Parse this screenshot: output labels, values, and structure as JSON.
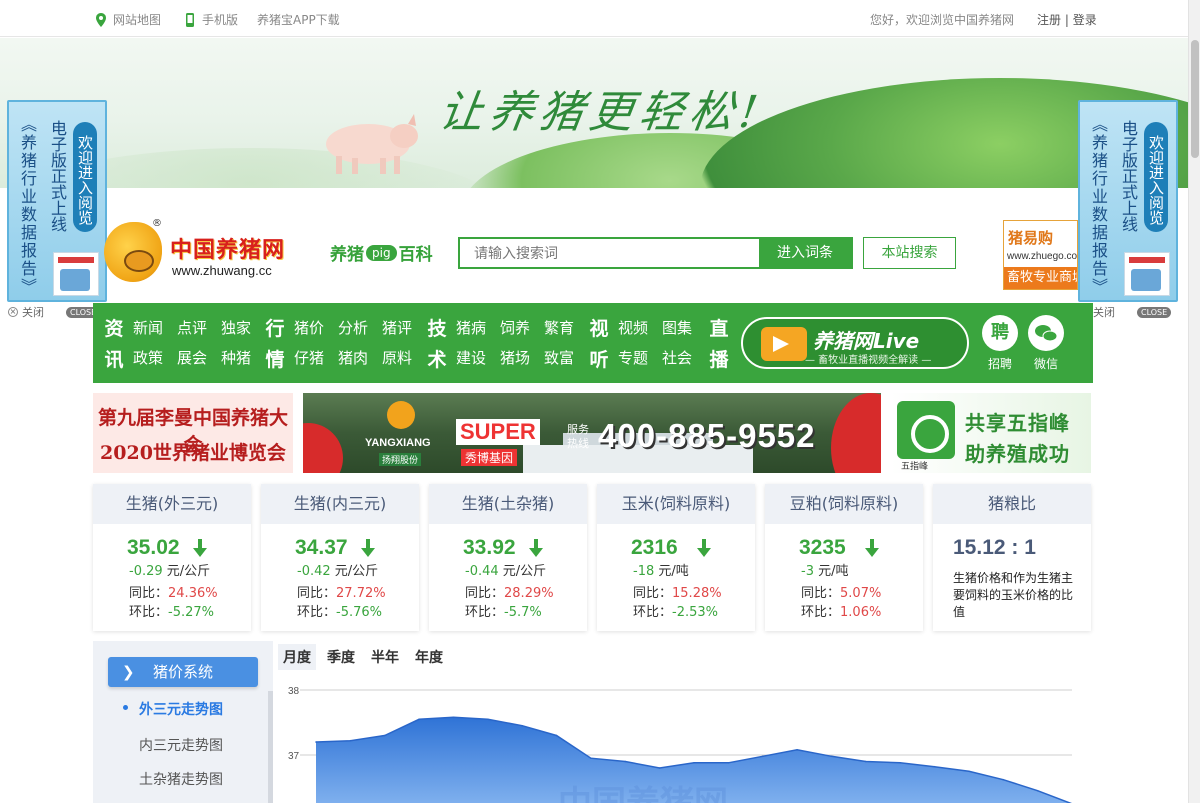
{
  "topbar": {
    "sitemap": "网站地图",
    "mobile": "手机版",
    "app": "养猪宝APP下载",
    "welcome": "您好，欢迎浏览中国养猪网",
    "register": "注册",
    "separator": "|",
    "login": "登录"
  },
  "banner": {
    "slogan": "让养猪更轻松!"
  },
  "float_ads": {
    "left": {
      "line1": "《养猪行业数据报告》",
      "line2": "电子版正式上线",
      "cta": "欢迎进入阅览",
      "close_label": "关闭",
      "close_btn": "CLOSE"
    },
    "right": {
      "line1": "《养猪行业数据报告》",
      "line2": "电子版正式上线",
      "cta": "欢迎进入阅览",
      "close_label": "关闭",
      "close_btn": "CLOSE"
    }
  },
  "logo": {
    "reg": "®",
    "name": "中国养猪网",
    "url": "www.zhuwang.cc"
  },
  "baike": {
    "left": "养猪",
    "tag": "pig",
    "right": "百科"
  },
  "search": {
    "placeholder": "请输入搜索词",
    "enter_btn": "进入词条",
    "site_btn": "本站搜索"
  },
  "zhuego": {
    "title": "猪易购",
    "url": "www.zhuego.com",
    "slogan": "畜牧专业商城"
  },
  "nav": {
    "groups": [
      {
        "big_top": "资",
        "big_bottom": "讯",
        "top": [
          "新闻",
          "点评",
          "独家"
        ],
        "bottom": [
          "政策",
          "展会",
          "种猪"
        ]
      },
      {
        "big_top": "行",
        "big_bottom": "情",
        "top": [
          "猪价",
          "分析",
          "猪评"
        ],
        "bottom": [
          "仔猪",
          "猪肉",
          "原料"
        ]
      },
      {
        "big_top": "技",
        "big_bottom": "术",
        "top": [
          "猪病",
          "饲养",
          "繁育"
        ],
        "bottom": [
          "建设",
          "猪场",
          "致富"
        ]
      },
      {
        "big_top": "视",
        "big_bottom": "听",
        "top": [
          "视频",
          "图集"
        ],
        "bottom": [
          "专题",
          "社会"
        ]
      },
      {
        "big_top": "直",
        "big_bottom": "播",
        "top": [],
        "bottom": []
      }
    ],
    "live_title": "养猪网Live",
    "live_sub": "— 畜牧业直播视频全解读 —",
    "jobs_icon": "聘",
    "jobs": "招聘",
    "wechat": "微信"
  },
  "ads": {
    "ad1": {
      "line1": "第九届李曼中国养猪大会",
      "line2": "2020世界猪业博览会"
    },
    "ad2": {
      "brand1": "YANGXIANG",
      "brand1_sub": "扬翔股份",
      "brand2": "SUPER",
      "brand2_sub": "秀博基因",
      "hotline_label": "服务热线",
      "hotline": "400-885-9552"
    },
    "ad3": {
      "brand": "五指峰",
      "line1": "共享五指峰",
      "line2": "助养殖成功"
    }
  },
  "prices": [
    {
      "title": "生猪(外三元)",
      "price": "35.02",
      "delta": "-0.29",
      "unit": "元/公斤",
      "yoy_label": "同比：",
      "yoy": "24.36%",
      "mom_label": "环比：",
      "mom": "-5.27%",
      "yoy_color": "#e04848",
      "mom_color": "#3aa53e",
      "direction": "down"
    },
    {
      "title": "生猪(内三元)",
      "price": "34.37",
      "delta": "-0.42",
      "unit": "元/公斤",
      "yoy_label": "同比：",
      "yoy": "27.72%",
      "mom_label": "环比：",
      "mom": "-5.76%",
      "yoy_color": "#e04848",
      "mom_color": "#3aa53e",
      "direction": "down"
    },
    {
      "title": "生猪(土杂猪)",
      "price": "33.92",
      "delta": "-0.44",
      "unit": "元/公斤",
      "yoy_label": "同比：",
      "yoy": "28.29%",
      "mom_label": "环比：",
      "mom": "-5.7%",
      "yoy_color": "#e04848",
      "mom_color": "#3aa53e",
      "direction": "down"
    },
    {
      "title": "玉米(饲料原料)",
      "price": "2316",
      "delta": "-18",
      "unit": "元/吨",
      "yoy_label": "同比：",
      "yoy": "15.28%",
      "mom_label": "环比：",
      "mom": "-2.53%",
      "yoy_color": "#e04848",
      "mom_color": "#3aa53e",
      "direction": "down"
    },
    {
      "title": "豆粕(饲料原料)",
      "price": "3235",
      "delta": "-3",
      "unit": "元/吨",
      "yoy_label": "同比：",
      "yoy": "5.07%",
      "mom_label": "环比：",
      "mom": "1.06%",
      "yoy_color": "#e04848",
      "mom_color": "#e04848",
      "direction": "down"
    }
  ],
  "ratio": {
    "title": "猪粮比",
    "value": "15.12 : 1",
    "desc": "生猪价格和作为生猪主要饲料的玉米价格的比值"
  },
  "sidebar": {
    "button": "猪价系统",
    "items": [
      {
        "label": "外三元走势图",
        "active": true
      },
      {
        "label": "内三元走势图",
        "active": false
      },
      {
        "label": "土杂猪走势图",
        "active": false
      }
    ]
  },
  "tabs": [
    "月度",
    "季度",
    "半年",
    "年度"
  ],
  "colors": {
    "brand_green": "#3aa53e",
    "accent_blue": "#4a90e2",
    "up_red": "#e04848"
  },
  "chart_data": {
    "type": "area",
    "title": "",
    "watermark": "中国养猪网",
    "ylim": [
      36,
      38
    ],
    "yticks": [
      38,
      37
    ],
    "x": [
      1,
      2,
      3,
      4,
      5,
      6,
      7,
      8,
      9,
      10,
      11,
      12,
      13,
      14,
      15,
      16,
      17,
      18,
      19,
      20,
      21,
      22,
      23
    ],
    "values": [
      37.2,
      37.22,
      37.3,
      37.55,
      37.58,
      37.55,
      37.45,
      37.3,
      36.95,
      36.9,
      36.8,
      36.88,
      36.88,
      36.98,
      37.08,
      36.98,
      36.9,
      36.88,
      36.82,
      36.75,
      36.62,
      36.45,
      36.25
    ],
    "grid": true
  }
}
